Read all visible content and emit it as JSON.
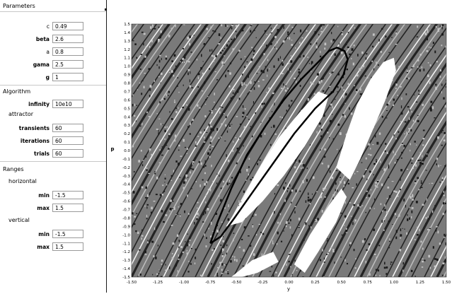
{
  "parameters": {
    "title": "Parameters",
    "fields": [
      {
        "label": "c",
        "value": "0.49",
        "bold": false
      },
      {
        "label": "beta",
        "value": "2.6",
        "bold": true
      },
      {
        "label": "a",
        "value": "0.8",
        "bold": false
      },
      {
        "label": "gama",
        "value": "2.5",
        "bold": true
      },
      {
        "label": "g",
        "value": "1",
        "bold": false
      }
    ]
  },
  "algorithm": {
    "title": "Algorithm",
    "infinity_label": "infinity",
    "infinity_value": "10e10",
    "attractor_title": "attractor",
    "fields": [
      {
        "label": "transients",
        "value": "60"
      },
      {
        "label": "iterations",
        "value": "60"
      },
      {
        "label": "trials",
        "value": "60"
      }
    ]
  },
  "ranges": {
    "title": "Ranges",
    "horizontal": {
      "title": "horizontal",
      "min_label": "min",
      "min_value": "-1.5",
      "max_label": "max",
      "max_value": "1.5"
    },
    "vertical": {
      "title": "vertical",
      "min_label": "min",
      "min_value": "-1.5",
      "max_label": "max",
      "max_value": "1.5"
    }
  },
  "plot": {
    "xlabel": "y",
    "ylabel": "p",
    "x_ticks": [
      "-1.50",
      "-1.25",
      "-1.00",
      "-0.75",
      "-0.50",
      "-0.25",
      "0.00",
      "0.25",
      "0.50",
      "0.75",
      "1.00",
      "1.25",
      "1.50"
    ],
    "y_ticks": [
      "1.5",
      "1.4",
      "1.3",
      "1.2",
      "1.1",
      "1.0",
      "0.9",
      "0.8",
      "0.7",
      "0.6",
      "0.5",
      "0.4",
      "0.3",
      "0.2",
      "0.1",
      "0.0",
      "-0.1",
      "-0.2",
      "-0.3",
      "-0.4",
      "-0.5",
      "-0.6",
      "-0.7",
      "-0.8",
      "-0.9",
      "-1.0",
      "-1.1",
      "-1.2",
      "-1.3",
      "-1.4",
      "-1.5"
    ],
    "xlim": [
      -1.5,
      1.5
    ],
    "ylim": [
      -1.5,
      1.5
    ],
    "orbit": [
      [
        -0.75,
        -1.1
      ],
      [
        -0.68,
        -0.85
      ],
      [
        -0.55,
        -0.45
      ],
      [
        -0.4,
        -0.05
      ],
      [
        -0.22,
        0.3
      ],
      [
        -0.05,
        0.6
      ],
      [
        0.12,
        0.85
      ],
      [
        0.28,
        1.05
      ],
      [
        0.38,
        1.18
      ],
      [
        0.46,
        1.22
      ],
      [
        0.53,
        1.18
      ],
      [
        0.56,
        1.08
      ],
      [
        0.52,
        0.9
      ],
      [
        0.42,
        0.7
      ],
      [
        0.25,
        0.5
      ],
      [
        0.05,
        0.2
      ],
      [
        -0.15,
        -0.15
      ],
      [
        -0.35,
        -0.5
      ],
      [
        -0.52,
        -0.8
      ],
      [
        -0.65,
        -1.02
      ],
      [
        -0.75,
        -1.1
      ]
    ],
    "white_regions": [
      [
        [
          -0.6,
          -0.9
        ],
        [
          -0.45,
          -0.6
        ],
        [
          -0.3,
          -0.25
        ],
        [
          -0.1,
          0.15
        ],
        [
          0.1,
          0.45
        ],
        [
          0.28,
          0.7
        ],
        [
          0.38,
          0.65
        ],
        [
          0.32,
          0.4
        ],
        [
          0.15,
          0.05
        ],
        [
          -0.05,
          -0.3
        ],
        [
          -0.25,
          -0.6
        ],
        [
          -0.45,
          -0.85
        ]
      ],
      [
        [
          0.45,
          -0.2
        ],
        [
          0.55,
          0.2
        ],
        [
          0.65,
          0.55
        ],
        [
          0.78,
          0.85
        ],
        [
          0.9,
          1.05
        ],
        [
          1.0,
          1.1
        ],
        [
          1.02,
          0.95
        ],
        [
          0.92,
          0.6
        ],
        [
          0.8,
          0.25
        ],
        [
          0.68,
          -0.1
        ],
        [
          0.58,
          -0.35
        ]
      ],
      [
        [
          0.05,
          -1.35
        ],
        [
          0.2,
          -1.0
        ],
        [
          0.38,
          -0.65
        ],
        [
          0.5,
          -0.45
        ],
        [
          0.55,
          -0.55
        ],
        [
          0.45,
          -0.85
        ],
        [
          0.28,
          -1.2
        ],
        [
          0.15,
          -1.45
        ]
      ],
      [
        [
          -0.55,
          -1.5
        ],
        [
          -0.35,
          -1.3
        ],
        [
          -0.15,
          -1.2
        ],
        [
          -0.1,
          -1.32
        ],
        [
          -0.3,
          -1.45
        ],
        [
          -0.45,
          -1.5
        ]
      ]
    ],
    "colors": {
      "dark": "#1a1a1a",
      "mid": "#7a7a7a",
      "light": "#c4c4c4",
      "white": "#ffffff"
    }
  }
}
